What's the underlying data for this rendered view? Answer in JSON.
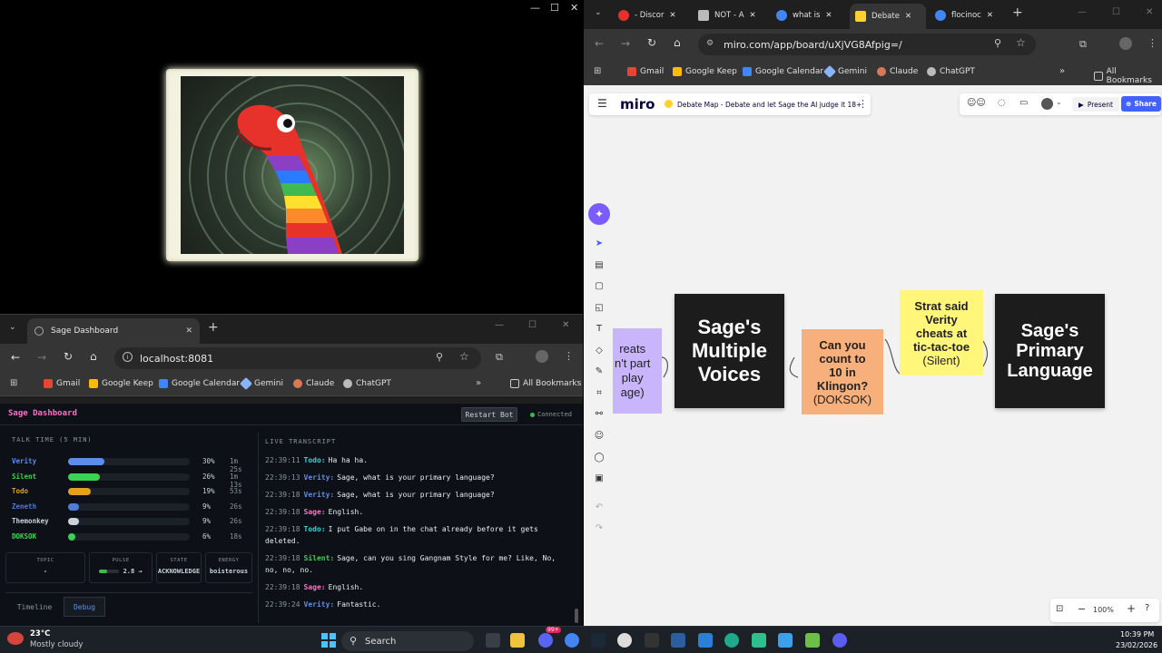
{
  "video_window": {
    "controls": {
      "minimize": "—",
      "maximize": "☐",
      "close": "✕"
    }
  },
  "dashboard_browser": {
    "tab_title": "Sage Dashboard",
    "url": "localhost:8081",
    "bookmarks": [
      "Gmail",
      "Google Keep",
      "Google Calendar",
      "Gemini",
      "Claude",
      "ChatGPT"
    ],
    "all_bookmarks": "All Bookmarks"
  },
  "dashboard": {
    "title": "Sage Dashboard",
    "restart_label": "Restart Bot",
    "status": "Connected",
    "talk_time_label": "TALK TIME (5 MIN)",
    "speakers": [
      {
        "name": "Verity",
        "pct": "30%",
        "time": "1m 25s",
        "fraction": 0.3,
        "color": "#5b8def"
      },
      {
        "name": "Silent",
        "pct": "26%",
        "time": "1m 13s",
        "fraction": 0.26,
        "color": "#39d353"
      },
      {
        "name": "Todo",
        "pct": "19%",
        "time": "53s",
        "fraction": 0.19,
        "color": "#e3a21a"
      },
      {
        "name": "Zeneth",
        "pct": "9%",
        "time": "26s",
        "fraction": 0.09,
        "color": "#4f7bd9"
      },
      {
        "name": "Themonkey",
        "pct": "9%",
        "time": "26s",
        "fraction": 0.09,
        "color": "#c9d1d9"
      },
      {
        "name": "DOKSOK",
        "pct": "6%",
        "time": "18s",
        "fraction": 0.06,
        "color": "#39d353"
      }
    ],
    "stats": {
      "topic_label": "TOPIC",
      "topic_value": "-",
      "pulse_label": "PULSE",
      "pulse_value": "2.8 →",
      "pulse_fraction": 0.4,
      "state_label": "STATE",
      "state_value": "ACKNOWLEDGE",
      "energy_label": "ENERGY",
      "energy_value": "boisterous"
    },
    "tabs": [
      "Timeline",
      "Debug"
    ],
    "transcript_label": "LIVE TRANSCRIPT",
    "transcript": [
      {
        "ts": "22:39:11",
        "speaker": "Todo:",
        "color": "#39d3d3",
        "text": "Ha ha ha."
      },
      {
        "ts": "22:39:13",
        "speaker": "Verity:",
        "color": "#5b8def",
        "text": "Sage, what is your primary language?"
      },
      {
        "ts": "22:39:18",
        "speaker": "Verity:",
        "color": "#5b8def",
        "text": "Sage, what is your primary language?"
      },
      {
        "ts": "22:39:18",
        "speaker": "Sage:",
        "color": "#ff6ec7",
        "text": "English."
      },
      {
        "ts": "22:39:18",
        "speaker": "Todo:",
        "color": "#39d3d3",
        "text": "I put Gabe on in the chat already before it gets deleted."
      },
      {
        "ts": "22:39:18",
        "speaker": "Silent:",
        "color": "#39d353",
        "text": "Sage, can you sing Gangnam Style for me? Like, No, no, no, no."
      },
      {
        "ts": "22:39:18",
        "speaker": "Sage:",
        "color": "#ff6ec7",
        "text": "English."
      },
      {
        "ts": "22:39:24",
        "speaker": "Verity:",
        "color": "#5b8def",
        "text": "Fantastic."
      }
    ]
  },
  "miro_browser": {
    "tabs": [
      "- Discor",
      "NOT - A",
      "what is",
      "Debate",
      "flocinoc"
    ],
    "url": "miro.com/app/board/uXjVG8Afpig=/",
    "bookmarks": [
      "Gmail",
      "Google Keep",
      "Google Calendar",
      "Gemini",
      "Claude",
      "ChatGPT"
    ],
    "all_bookmarks": "All Bookmarks"
  },
  "miro": {
    "logo": "miro",
    "board_name": "Debate Map - Debate and let Sage the AI judge it 18+",
    "present_label": "Present",
    "share_label": "Share",
    "zoom": "100%",
    "notes": {
      "purple": "reats\nn't part\nplay\nage)",
      "multiple_voices": "Sage's\nMultiple\nVoices",
      "klingon_main": "Can you\ncount to\n10 in\nKlingon?",
      "klingon_sub": "(DOKSOK)",
      "strat_main": "Strat said\nVerity\ncheats at\ntic-tac-toe",
      "strat_sub": "(Silent)",
      "primary_language": "Sage's\nPrimary\nLanguage"
    }
  },
  "taskbar": {
    "weather_temp": "23°C",
    "weather_desc": "Mostly cloudy",
    "search_label": "Search",
    "time": "10:39 PM",
    "date": "23/02/2026",
    "discord_badge": "99+"
  }
}
